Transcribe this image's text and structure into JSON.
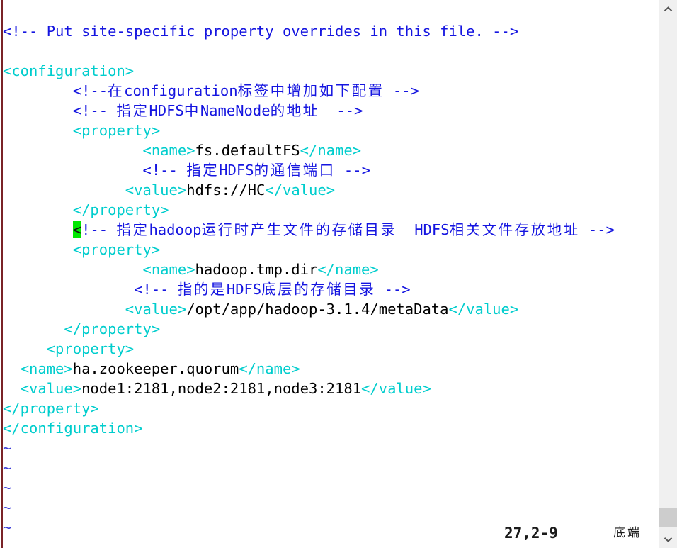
{
  "app": {
    "kind": "terminal-text-editor",
    "colors": {
      "background": "#ffffff",
      "tag": "#00cdcd",
      "comment": "#1515e0",
      "text": "#000000",
      "cursor_highlight": "#00e800",
      "window_edge": "#7a2327",
      "scrollbar_track": "#f0f0f0",
      "scrollbar_thumb": "#cdcdcd"
    }
  },
  "editor": {
    "lines": [
      {
        "id": "line-1",
        "indent": "",
        "segments": [
          {
            "cls": "comment",
            "text": "<!-- Put site-specific property overrides in this file. -->"
          }
        ]
      },
      {
        "id": "line-2",
        "indent": "",
        "segments": []
      },
      {
        "id": "line-3",
        "indent": "",
        "segments": [
          {
            "cls": "tag",
            "text": "<configuration>"
          }
        ]
      },
      {
        "id": "line-4",
        "indent": "        ",
        "segments": [
          {
            "cls": "comment",
            "text": "<!--"
          },
          {
            "cls": "comment cjk",
            "text": "在"
          },
          {
            "cls": "comment",
            "text": "configuration"
          },
          {
            "cls": "comment cjk",
            "text": "标签中增加如下配置"
          },
          {
            "cls": "comment",
            "text": " -->"
          }
        ]
      },
      {
        "id": "line-5",
        "indent": "        ",
        "segments": [
          {
            "cls": "comment",
            "text": "<!-- "
          },
          {
            "cls": "comment cjk",
            "text": "指定"
          },
          {
            "cls": "comment",
            "text": "HDFS"
          },
          {
            "cls": "comment cjk",
            "text": "中"
          },
          {
            "cls": "comment",
            "text": "NameNode"
          },
          {
            "cls": "comment cjk",
            "text": "的地址"
          },
          {
            "cls": "comment",
            "text": "  -->"
          }
        ]
      },
      {
        "id": "line-6",
        "indent": "        ",
        "segments": [
          {
            "cls": "tag",
            "text": "<property>"
          }
        ]
      },
      {
        "id": "line-7",
        "indent": "                ",
        "segments": [
          {
            "cls": "tag",
            "text": "<name>"
          },
          {
            "cls": "txt",
            "text": "fs.defaultFS"
          },
          {
            "cls": "tag",
            "text": "</name>"
          }
        ]
      },
      {
        "id": "line-8",
        "indent": "                ",
        "segments": [
          {
            "cls": "comment",
            "text": "<!-- "
          },
          {
            "cls": "comment cjk",
            "text": "指定"
          },
          {
            "cls": "comment",
            "text": "HDFS"
          },
          {
            "cls": "comment cjk",
            "text": "的通信端口"
          },
          {
            "cls": "comment",
            "text": " -->"
          }
        ]
      },
      {
        "id": "line-9",
        "indent": "              ",
        "segments": [
          {
            "cls": "tag",
            "text": "<value>"
          },
          {
            "cls": "txt",
            "text": "hdfs://HC"
          },
          {
            "cls": "tag",
            "text": "</value>"
          }
        ]
      },
      {
        "id": "line-10",
        "indent": "        ",
        "segments": [
          {
            "cls": "tag",
            "text": "</property>"
          }
        ]
      },
      {
        "id": "line-11",
        "indent": "        ",
        "segments": [
          {
            "cls": "cursor",
            "text": "<"
          },
          {
            "cls": "comment",
            "text": "!-- "
          },
          {
            "cls": "comment cjk",
            "text": "指定"
          },
          {
            "cls": "comment",
            "text": "hadoop"
          },
          {
            "cls": "comment cjk",
            "text": "运行时产生文件的存储目录"
          },
          {
            "cls": "comment",
            "text": "  "
          },
          {
            "cls": "comment",
            "text": "HDFS"
          },
          {
            "cls": "comment cjk",
            "text": "相关文件存放地址"
          },
          {
            "cls": "comment",
            "text": " -->"
          }
        ]
      },
      {
        "id": "line-12",
        "indent": "        ",
        "segments": [
          {
            "cls": "tag",
            "text": "<property>"
          }
        ]
      },
      {
        "id": "line-13",
        "indent": "                ",
        "segments": [
          {
            "cls": "tag",
            "text": "<name>"
          },
          {
            "cls": "txt",
            "text": "hadoop.tmp.dir"
          },
          {
            "cls": "tag",
            "text": "</name>"
          }
        ]
      },
      {
        "id": "line-14",
        "indent": "               ",
        "segments": [
          {
            "cls": "comment",
            "text": "<!-- "
          },
          {
            "cls": "comment cjk",
            "text": "指的是"
          },
          {
            "cls": "comment",
            "text": "HDFS"
          },
          {
            "cls": "comment cjk",
            "text": "底层的存储目录"
          },
          {
            "cls": "comment",
            "text": " -->"
          }
        ]
      },
      {
        "id": "line-15",
        "indent": "              ",
        "segments": [
          {
            "cls": "tag",
            "text": "<value>"
          },
          {
            "cls": "txt",
            "text": "/opt/app/hadoop-3.1.4/metaData"
          },
          {
            "cls": "tag",
            "text": "</value>"
          }
        ]
      },
      {
        "id": "line-16",
        "indent": "       ",
        "segments": [
          {
            "cls": "tag",
            "text": "</property>"
          }
        ]
      },
      {
        "id": "line-17",
        "indent": "     ",
        "segments": [
          {
            "cls": "tag",
            "text": "<property>"
          }
        ]
      },
      {
        "id": "line-18",
        "indent": "  ",
        "segments": [
          {
            "cls": "tag",
            "text": "<name>"
          },
          {
            "cls": "txt",
            "text": "ha.zookeeper.quorum"
          },
          {
            "cls": "tag",
            "text": "</name>"
          }
        ]
      },
      {
        "id": "line-19",
        "indent": "  ",
        "segments": [
          {
            "cls": "tag",
            "text": "<value>"
          },
          {
            "cls": "txt",
            "text": "node1:2181,node2:2181,node3:2181"
          },
          {
            "cls": "tag",
            "text": "</value>"
          }
        ]
      },
      {
        "id": "line-20",
        "indent": "",
        "segments": [
          {
            "cls": "tag",
            "text": "</property>"
          }
        ]
      },
      {
        "id": "line-21",
        "indent": "",
        "segments": [
          {
            "cls": "tag",
            "text": "</configuration>"
          }
        ]
      },
      {
        "id": "line-22",
        "indent": "",
        "segments": [
          {
            "cls": "tilde",
            "text": "~"
          }
        ]
      },
      {
        "id": "line-23",
        "indent": "",
        "segments": [
          {
            "cls": "tilde",
            "text": "~"
          }
        ]
      },
      {
        "id": "line-24",
        "indent": "",
        "segments": [
          {
            "cls": "tilde",
            "text": "~"
          }
        ]
      },
      {
        "id": "line-25",
        "indent": "",
        "segments": [
          {
            "cls": "tilde",
            "text": "~"
          }
        ]
      },
      {
        "id": "line-26",
        "indent": "",
        "segments": [
          {
            "cls": "tilde",
            "text": "~"
          }
        ]
      }
    ]
  },
  "status": {
    "position": "27,2-9",
    "where": "底端"
  },
  "scrollbar": {
    "up_icon": "chevron-up-icon",
    "down_icon": "chevron-down-icon"
  }
}
